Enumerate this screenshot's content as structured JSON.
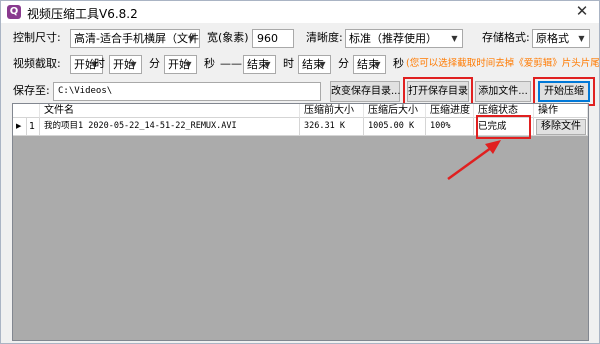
{
  "window": {
    "title": "视频压缩工具V6.8.2",
    "icon_letter": "Q",
    "close_glyph": "✕"
  },
  "controls": {
    "size_label": "控制尺寸:",
    "size_value": "高清-适合手机横屏（文件大）",
    "width_label": "宽(象素)",
    "width_value": "960",
    "clarity_label": "清晰度:",
    "clarity_value": "标准（推荐使用）",
    "format_label": "存储格式:",
    "format_value": "原格式"
  },
  "clip": {
    "label": "视频截取:",
    "start_hour": "开始",
    "hour_unit": "时",
    "start_min": "开始",
    "min_unit": "分",
    "start_sec": "开始",
    "sec_unit": "秒",
    "dash": "——",
    "end_hour": "结束",
    "hour_unit2": "时",
    "end_min": "结束",
    "min_unit2": "分",
    "end_sec": "结束",
    "sec_unit2": "秒",
    "hint": "(您可以选择截取时间去掉《爱剪辑》片头片尾)"
  },
  "save": {
    "label": "保存至:",
    "path": "C:\\Videos\\",
    "change_dir_label": "改变保存目录...",
    "open_dir_label": "打开保存目录",
    "add_file_label": "添加文件...",
    "start_label": "开始压缩"
  },
  "table": {
    "columns": [
      "文件名",
      "压缩前大小",
      "压缩后大小",
      "压缩进度",
      "压缩状态",
      "操作"
    ],
    "rows": [
      {
        "indicator": "▶",
        "index": "1",
        "filename": "我的项目1 2020-05-22_14-51-22_REMUX.AVI",
        "size_before": "326.31 K",
        "size_after": "1005.00 K",
        "progress": "100%",
        "status": "已完成",
        "action": "移除文件"
      }
    ]
  },
  "colors": {
    "highlight_red": "#e02020",
    "hint_orange": "#ff7a00",
    "accent_blue": "#0078d7"
  }
}
